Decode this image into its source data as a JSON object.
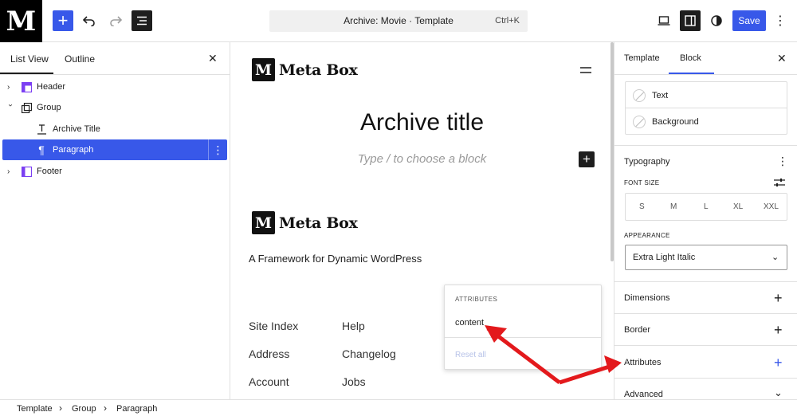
{
  "topbar": {
    "logo": "M",
    "command_title": "Archive: Movie · Template",
    "command_shortcut": "Ctrl+K",
    "save_label": "Save",
    "icons": [
      "plus-icon",
      "undo-icon",
      "redo-icon",
      "list-view-icon",
      "desktop-icon",
      "sidebar-icon",
      "contrast-icon",
      "more-vertical-icon"
    ]
  },
  "left_panel": {
    "tabs": [
      "List View",
      "Outline"
    ],
    "active_tab": "List View",
    "tree": [
      {
        "label": "Header",
        "icon": "header-icon"
      },
      {
        "label": "Group",
        "icon": "group-icon"
      },
      {
        "label": "Archive Title",
        "icon": "title-icon"
      },
      {
        "label": "Paragraph",
        "icon": "paragraph-icon"
      },
      {
        "label": "Footer",
        "icon": "footer-icon"
      }
    ]
  },
  "canvas": {
    "logo_mark": "M",
    "logo_text": "Meta Box",
    "archive_title": "Archive title",
    "placeholder": "Type / to choose a block",
    "footer_logo_mark": "M",
    "footer_logo_text": "Meta Box",
    "tagline": "A Framework for Dynamic WordPress",
    "footer_links": {
      "col1": [
        "Site Index",
        "Address",
        "Account"
      ],
      "col2": [
        "Help",
        "Changelog",
        "Jobs"
      ]
    }
  },
  "attributes_popover": {
    "heading": "ATTRIBUTES",
    "item": "content",
    "reset": "Reset all"
  },
  "right_panel": {
    "tabs": [
      "Template",
      "Block"
    ],
    "active_tab": "Block",
    "color": {
      "text_label": "Text",
      "background_label": "Background"
    },
    "typography": {
      "title": "Typography",
      "font_size_label": "FONT SIZE",
      "sizes": [
        "S",
        "M",
        "L",
        "XL",
        "XXL"
      ],
      "appearance_label": "APPEARANCE",
      "appearance_value": "Extra Light Italic"
    },
    "sections": [
      "Dimensions",
      "Border",
      "Attributes",
      "Advanced"
    ]
  },
  "breadcrumb": [
    "Template",
    "Group",
    "Paragraph"
  ],
  "colors": {
    "accent": "#3858e9",
    "annotation_arrow": "#e3191c"
  }
}
